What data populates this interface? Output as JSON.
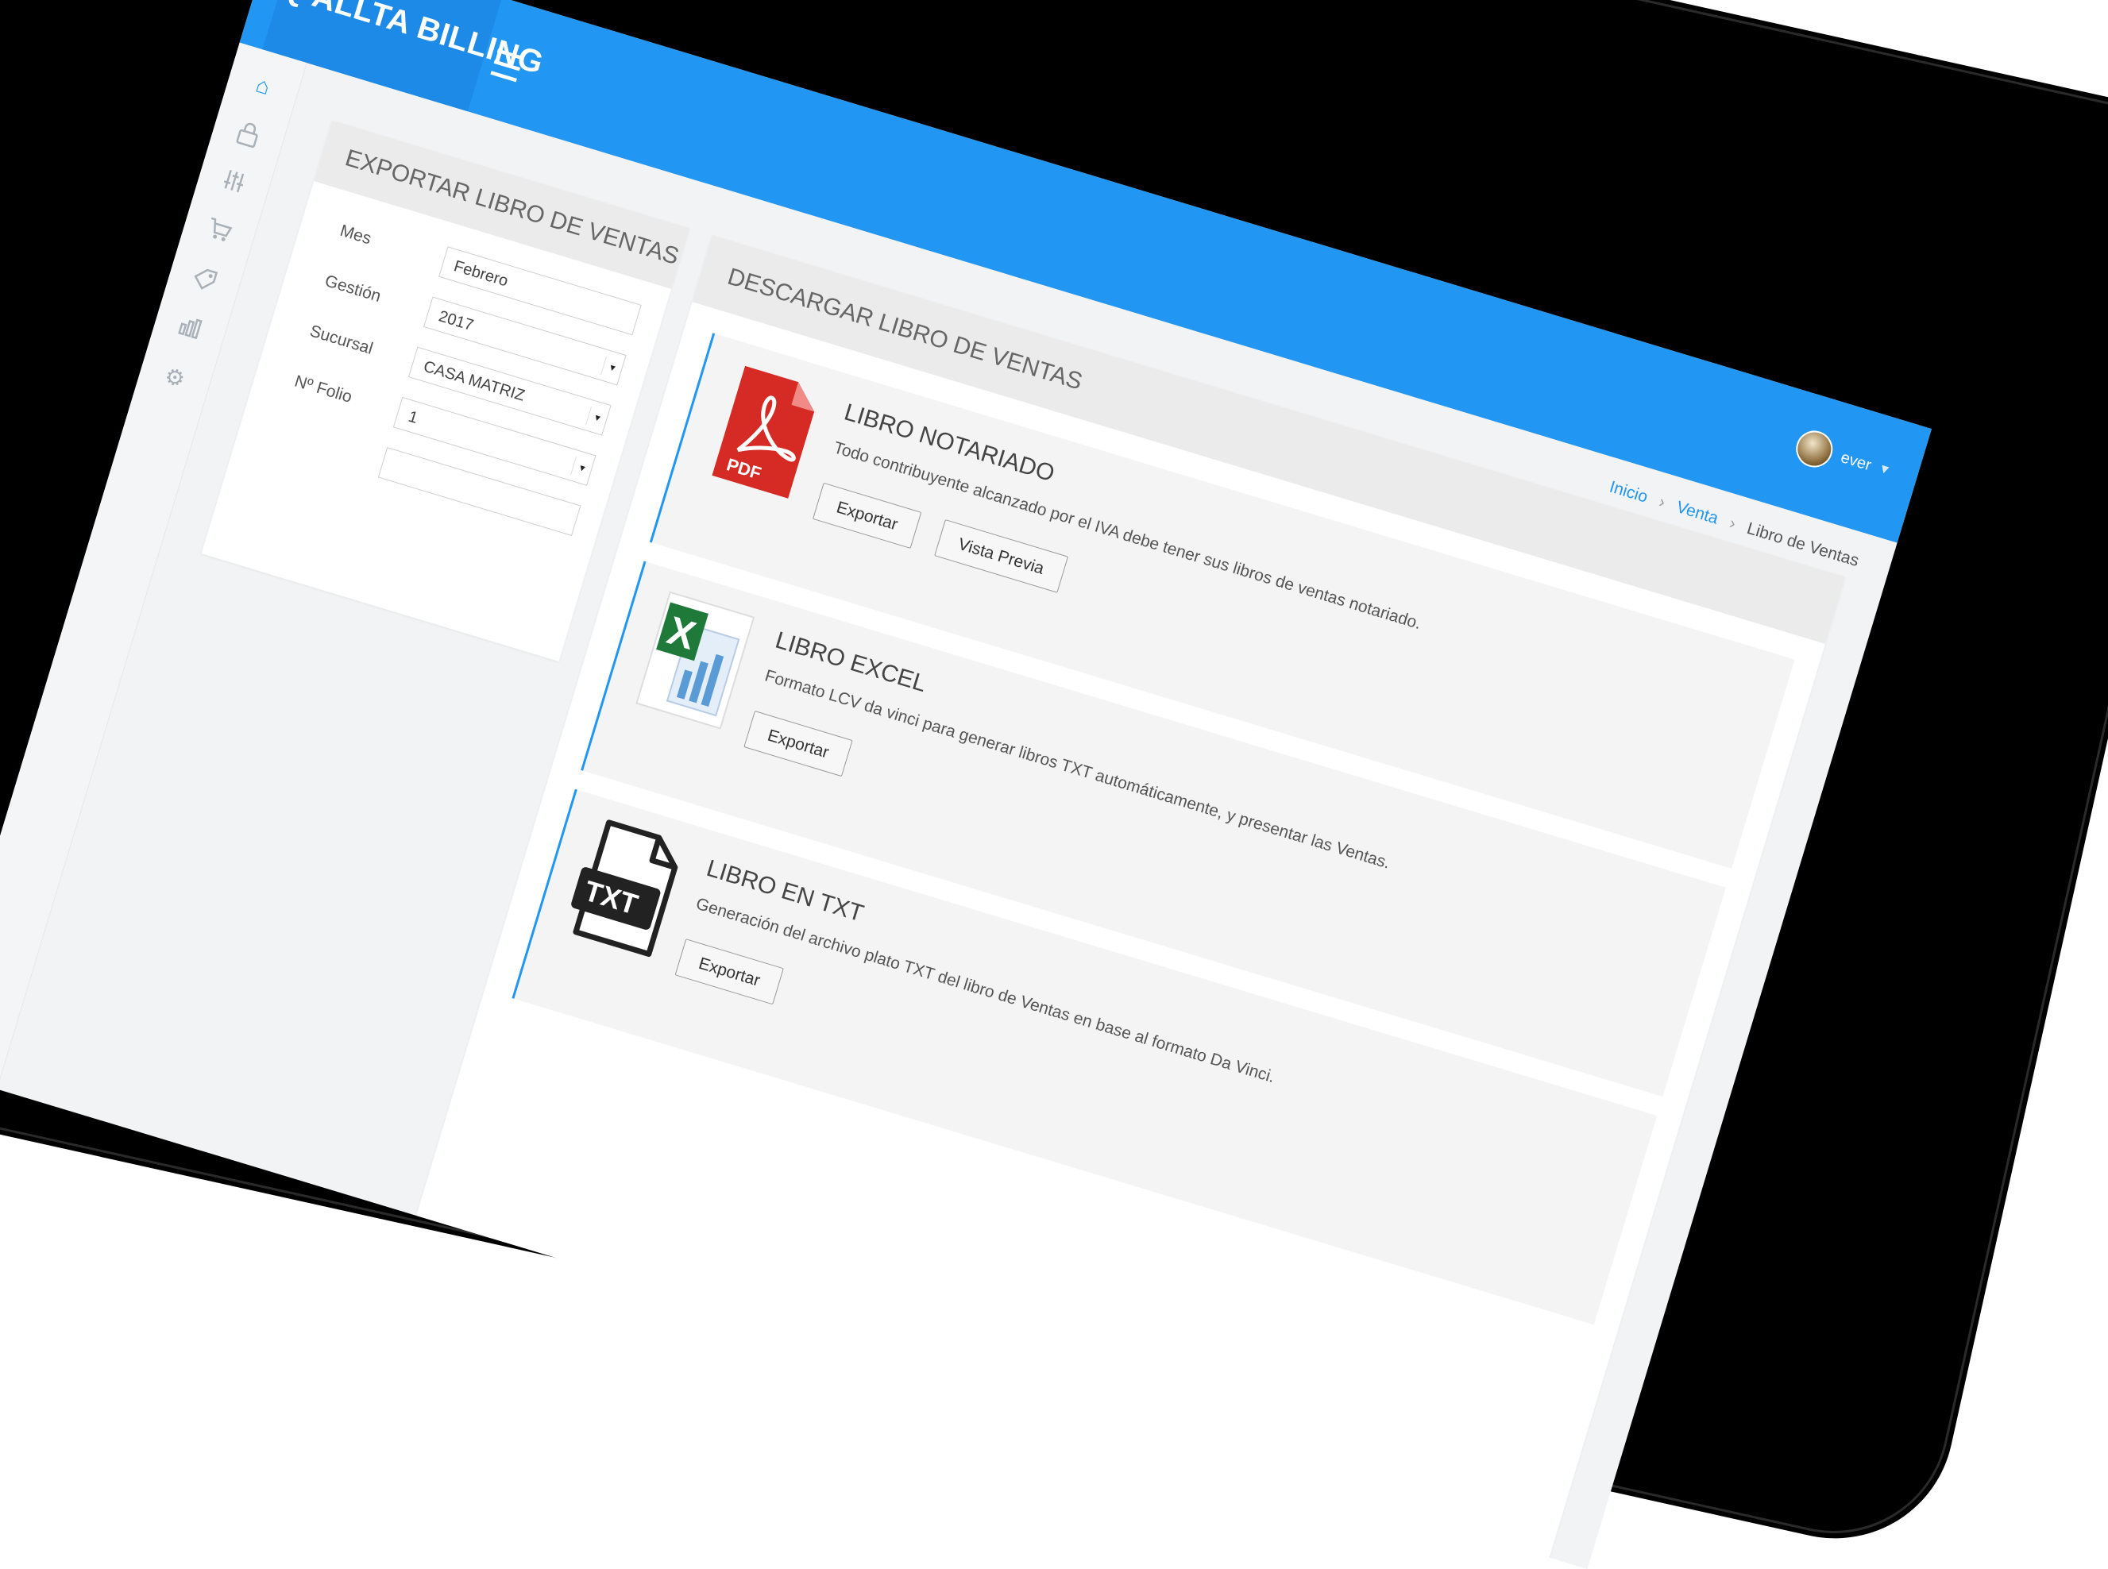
{
  "app": {
    "brand": "Q'ALLTA BILLING",
    "menu_icon": "hamburger-icon",
    "accent_color": "#2196f3"
  },
  "user": {
    "name": "ever"
  },
  "breadcrumb": {
    "home": "Inicio",
    "section": "Venta",
    "current": "Libro de Ventas"
  },
  "sidebar": {
    "icons": [
      "home-icon",
      "lock-icon",
      "sliders-icon",
      "cart-icon",
      "tag-icon",
      "chart-icon",
      "settings-icon"
    ]
  },
  "export_panel": {
    "title": "EXPORTAR LIBRO DE VENTAS",
    "fields": [
      {
        "label": "Mes",
        "value": "Febrero"
      },
      {
        "label": "Gestión",
        "value": "2017"
      },
      {
        "label": "Sucursal",
        "value": "CASA MATRIZ"
      },
      {
        "label": "Nº Folio",
        "value": "1"
      }
    ]
  },
  "download_panel": {
    "title": "DESCARGAR LIBRO DE VENTAS",
    "cards": [
      {
        "icon": "pdf-icon",
        "title": "LIBRO NOTARIADO",
        "description": "Todo contribuyente alcanzado por el IVA debe tener sus libros de ventas notariado.",
        "buttons": [
          "Exportar",
          "Vista Previa"
        ]
      },
      {
        "icon": "excel-icon",
        "title": "LIBRO EXCEL",
        "description": "Formato LCV da vinci para generar libros TXT automáticamente, y presentar las Ventas.",
        "buttons": [
          "Exportar"
        ]
      },
      {
        "icon": "txt-icon",
        "title": "LIBRO EN TXT",
        "description": "Generación del archivo plato TXT del libro de Ventas en base al formato Da Vinci.",
        "buttons": [
          "Exportar"
        ]
      }
    ]
  }
}
